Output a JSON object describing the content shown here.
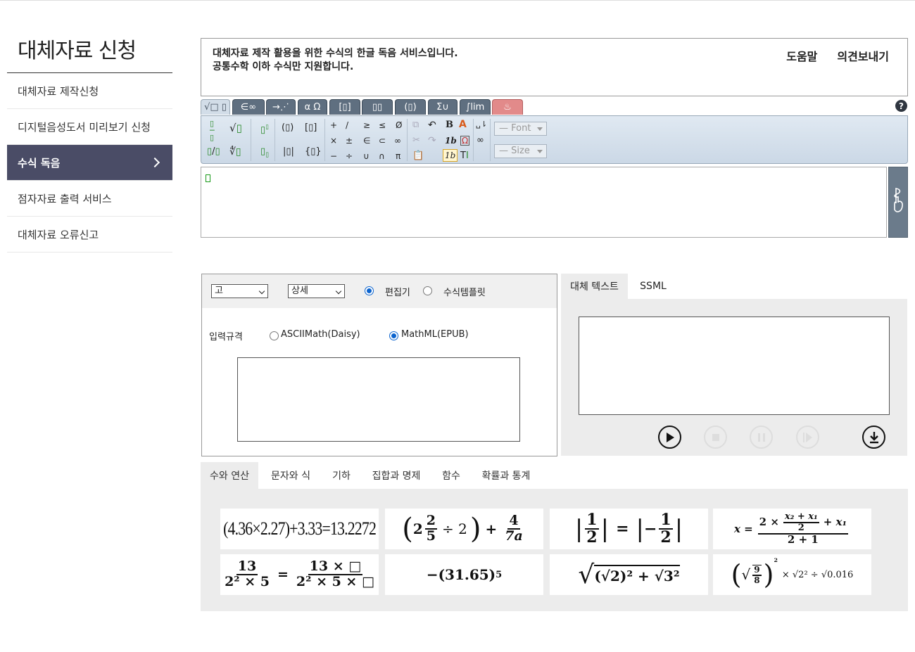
{
  "sidebar": {
    "title": "대체자료 신청",
    "items": [
      {
        "label": "대체자료 제작신청"
      },
      {
        "label": "디지털음성도서 미리보기 신청"
      },
      {
        "label": "수식 독음"
      },
      {
        "label": "점자자료 출력 서비스"
      },
      {
        "label": "대체자료 오류신고"
      }
    ],
    "active_index": 2
  },
  "info": {
    "line1": "대체자료 제작 활용을 위한 수식의 한글 독음 서비스입니다.",
    "line2": "공통수학 이하 수식만 지원합니다.",
    "help_link": "도움말",
    "feedback_link": "의견보내기"
  },
  "equation_editor": {
    "tabs": [
      "√□ ▯",
      "∈∞",
      "→⋰",
      "α Ω",
      "[▯]",
      "▯▯",
      "(▯)",
      "Σ∪",
      "∫lim",
      "♨"
    ],
    "help_label": "?",
    "font_select": "— Font",
    "size_select": "— Size",
    "palette": {
      "ops": [
        "+",
        "/",
        "≥",
        "≤",
        "Ø",
        "×",
        "±",
        "∈",
        "⊂",
        "∞",
        "−",
        "÷",
        "∪",
        "∩",
        "π"
      ],
      "fences": [
        "(▯)",
        "[▯]",
        "|▯|",
        "{▯}"
      ],
      "bold": "B",
      "italic": "1b"
    }
  },
  "options": {
    "level_select": "고",
    "detail_select": "상세",
    "mode_editor": "편집기",
    "mode_template": "수식템플릿",
    "input_format_label": "입력규격",
    "format_ascii": "ASCIIMath(Daisy)",
    "format_mathml": "MathML(EPUB)",
    "selected_mode": "편집기",
    "selected_format": "MathML(EPUB)",
    "input_value": ""
  },
  "result": {
    "tab_alt_text": "대체 텍스트",
    "tab_ssml": "SSML",
    "output_value": ""
  },
  "examples": {
    "tabs": [
      "수와 연산",
      "문자와 식",
      "기하",
      "집합과 명제",
      "함수",
      "확률과 통계"
    ],
    "active_tab": "수와 연산",
    "ex1": {
      "a": "(4.36×2.27)+3.33=13.2272"
    },
    "ex2": {
      "w": "2",
      "n1": "2",
      "d1": "5",
      "op": "÷ 2",
      "n2": "4",
      "d2": "7a"
    },
    "ex3": {
      "n": "1",
      "d": "2"
    },
    "ex4": {
      "lhs": "x =",
      "top": "2 ×",
      "n": "x₂ + x₁",
      "d": "2",
      "tail": "+ x₁",
      "bot": "2 + 1"
    },
    "ex5": {
      "n1": "13",
      "d1": "2² × 5",
      "n2": "13 × □",
      "d2": "2² × 5 × □"
    },
    "ex6": {
      "expr": "−(31.65)",
      "exp": "5"
    },
    "ex7": {
      "expr": "(√2)² + √3²"
    },
    "ex8": {
      "n": "9",
      "d": "8",
      "tail": "× √2² ÷ √0.016"
    }
  }
}
